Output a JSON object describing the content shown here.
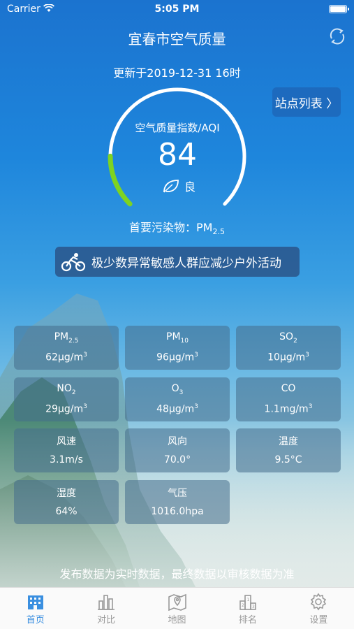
{
  "status_bar": {
    "carrier": "Carrier",
    "time": "5:05 PM"
  },
  "nav": {
    "title": "宜春市空气质量"
  },
  "updated": "更新于2019-12-31 16时",
  "station_button": "站点列表 〉",
  "aqi": {
    "label": "空气质量指数/AQI",
    "value": "84",
    "level": "良",
    "fraction": 0.168,
    "color": "#7ed321"
  },
  "primary_pollutant": {
    "prefix": "首要污染物：",
    "name": "PM",
    "sub": "2.5"
  },
  "advice": "极少数异常敏感人群应减少户外活动",
  "metrics": [
    {
      "name": "PM",
      "sub": "2.5",
      "value": "62μg/m",
      "sup": "3"
    },
    {
      "name": "PM",
      "sub": "10",
      "value": "96μg/m",
      "sup": "3"
    },
    {
      "name": "SO",
      "sub": "2",
      "value": "10μg/m",
      "sup": "3"
    },
    {
      "name": "NO",
      "sub": "2",
      "value": "29μg/m",
      "sup": "3"
    },
    {
      "name": "O",
      "sub": "3",
      "value": "48μg/m",
      "sup": "3"
    },
    {
      "name": "CO",
      "sub": "",
      "value": "1.1mg/m",
      "sup": "3"
    },
    {
      "name": "风速",
      "sub": "",
      "value": "3.1m/s",
      "sup": ""
    },
    {
      "name": "风向",
      "sub": "",
      "value": "70.0°",
      "sup": ""
    },
    {
      "name": "温度",
      "sub": "",
      "value": "9.5°C",
      "sup": ""
    },
    {
      "name": "湿度",
      "sub": "",
      "value": "64%",
      "sup": ""
    },
    {
      "name": "气压",
      "sub": "",
      "value": "1016.0hpa",
      "sup": ""
    }
  ],
  "footer_note": "发布数据为实时数据，最终数据以审核数据为准",
  "tabs": [
    {
      "label": "首页",
      "icon": "home-building-icon",
      "active": true
    },
    {
      "label": "对比",
      "icon": "bar-chart-icon",
      "active": false
    },
    {
      "label": "地图",
      "icon": "map-pin-icon",
      "active": false
    },
    {
      "label": "排名",
      "icon": "ranking-icon",
      "active": false
    },
    {
      "label": "设置",
      "icon": "gear-icon",
      "active": false
    }
  ]
}
